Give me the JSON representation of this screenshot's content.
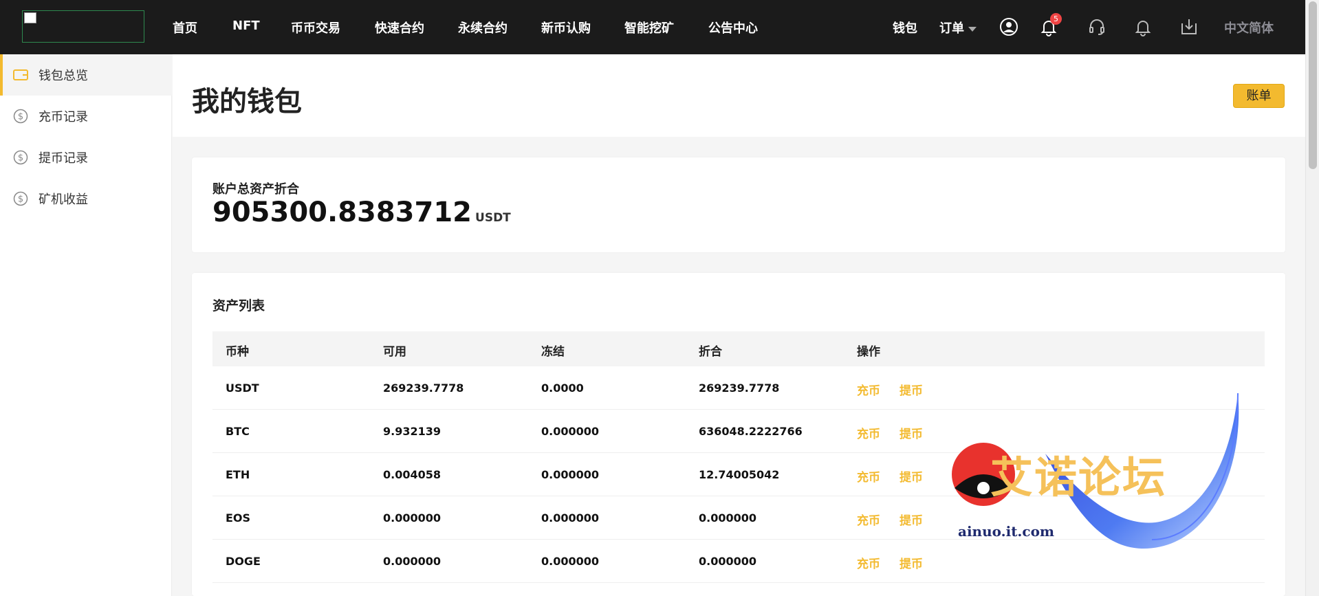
{
  "nav": {
    "items": [
      "首页",
      "NFT",
      "币币交易",
      "快速合约",
      "永续合约",
      "新币认购",
      "智能挖矿",
      "公告中心"
    ],
    "wallet": "钱包",
    "orders": "订单",
    "notification_count": "5",
    "language": "中文简体"
  },
  "sidebar": {
    "items": [
      {
        "label": "钱包总览",
        "icon": "wallet-icon"
      },
      {
        "label": "充币记录",
        "icon": "dollar-circle-icon"
      },
      {
        "label": "提币记录",
        "icon": "dollar-circle-icon"
      },
      {
        "label": "矿机收益",
        "icon": "dollar-circle-icon"
      }
    ]
  },
  "page": {
    "title": "我的钱包",
    "bill_button": "账单"
  },
  "total": {
    "label": "账户总资产折合",
    "value": "905300.8383712",
    "unit": "USDT"
  },
  "assets": {
    "title": "资产列表",
    "headers": [
      "币种",
      "可用",
      "冻结",
      "折合",
      "操作"
    ],
    "deposit_label": "充币",
    "withdraw_label": "提币",
    "rows": [
      {
        "coin": "USDT",
        "available": "269239.7778",
        "frozen": "0.0000",
        "converted": "269239.7778"
      },
      {
        "coin": "BTC",
        "available": "9.932139",
        "frozen": "0.000000",
        "converted": "636048.2222766"
      },
      {
        "coin": "ETH",
        "available": "0.004058",
        "frozen": "0.000000",
        "converted": "12.74005042"
      },
      {
        "coin": "EOS",
        "available": "0.000000",
        "frozen": "0.000000",
        "converted": "0.000000"
      },
      {
        "coin": "DOGE",
        "available": "0.000000",
        "frozen": "0.000000",
        "converted": "0.000000"
      }
    ]
  },
  "watermark": {
    "text": "艾诺论坛",
    "url": "ainuo.it.com"
  },
  "colors": {
    "accent": "#f3ba2f",
    "topbar": "#1b1b1b",
    "badge": "#ef4444"
  }
}
